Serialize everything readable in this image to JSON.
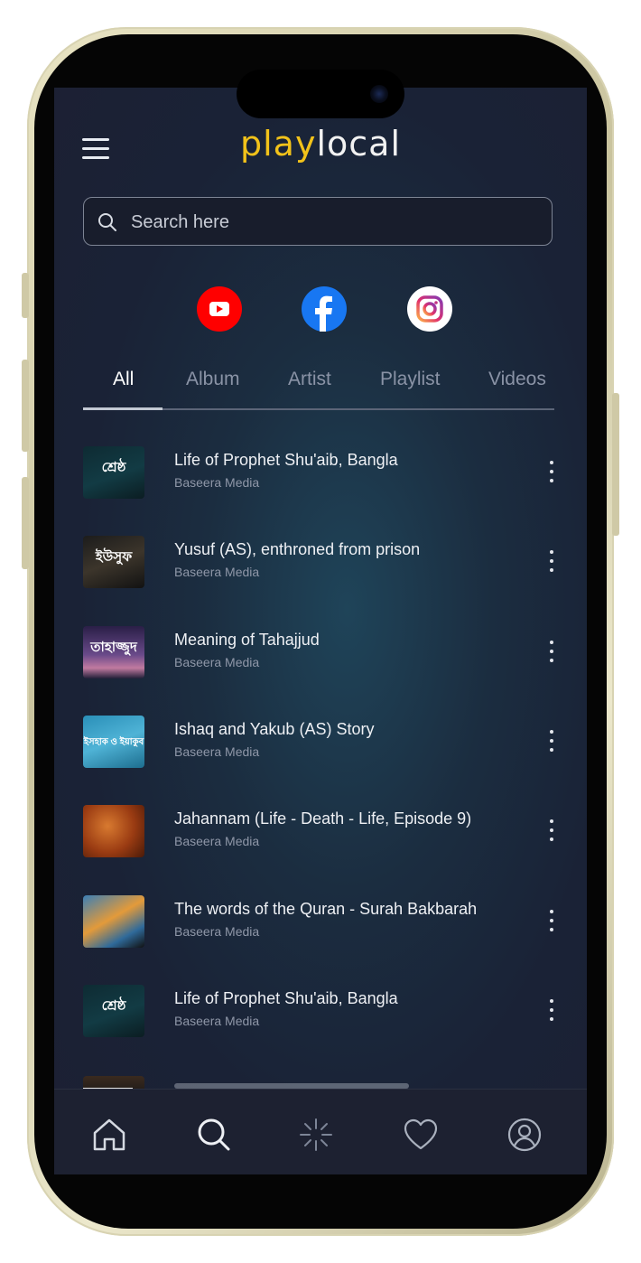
{
  "header": {
    "logo_part1": "play",
    "logo_part2": "local"
  },
  "search": {
    "placeholder": "Search here"
  },
  "social": [
    "youtube-icon",
    "facebook-icon",
    "instagram-icon"
  ],
  "tabs": [
    {
      "label": "All",
      "active": true
    },
    {
      "label": "Album",
      "active": false
    },
    {
      "label": "Artist",
      "active": false
    },
    {
      "label": "Playlist",
      "active": false
    },
    {
      "label": "Videos",
      "active": false
    }
  ],
  "tracks": [
    {
      "title": "Life of Prophet Shu'aib, Bangla",
      "artist": "Baseera Media",
      "thumb_text": "শ্রেষ্ঠ"
    },
    {
      "title": "Yusuf (AS), enthroned from prison",
      "artist": "Baseera Media",
      "thumb_text": "ইউসুফ"
    },
    {
      "title": "Meaning of Tahajjud",
      "artist": "Baseera Media",
      "thumb_text": "তাহাজ্জুদ"
    },
    {
      "title": "Ishaq and Yakub (AS) Story",
      "artist": "Baseera Media",
      "thumb_text": "ইসহাক ও ইয়াকুব"
    },
    {
      "title": "Jahannam (Life - Death - Life, Episode 9)",
      "artist": "Baseera Media",
      "thumb_text": ""
    },
    {
      "title": "The words of the Quran - Surah Bakbarah",
      "artist": "Baseera Media",
      "thumb_text": ""
    },
    {
      "title": "Life of Prophet Shu'aib, Bangla",
      "artist": "Baseera Media",
      "thumb_text": "শ্রেষ্ঠ"
    }
  ],
  "bottom_nav": [
    "home-icon",
    "search-icon",
    "discover-icon",
    "favorites-icon",
    "profile-icon"
  ],
  "colors": {
    "brand_yellow": "#f2c21a",
    "background": "#1a2236",
    "youtube": "#ff0000",
    "facebook": "#1877f2"
  }
}
